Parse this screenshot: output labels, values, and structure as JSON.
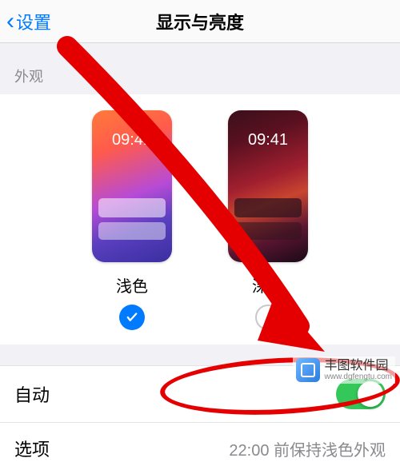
{
  "nav": {
    "back_label": "设置",
    "title": "显示与亮度"
  },
  "appearance": {
    "section_label": "外观",
    "preview_time": "09:41",
    "light": {
      "label": "浅色",
      "selected": true
    },
    "dark": {
      "label": "深色",
      "selected": false
    }
  },
  "rows": {
    "auto": {
      "label": "自动",
      "on": true
    },
    "options": {
      "label": "选项",
      "detail": "22:00 前保持浅色外观"
    }
  },
  "watermark": {
    "name": "丰图软件园",
    "url": "www.dgfengtu.com"
  },
  "colors": {
    "link": "#007aff",
    "switch_on": "#34c759",
    "annotation": "#e40000"
  }
}
